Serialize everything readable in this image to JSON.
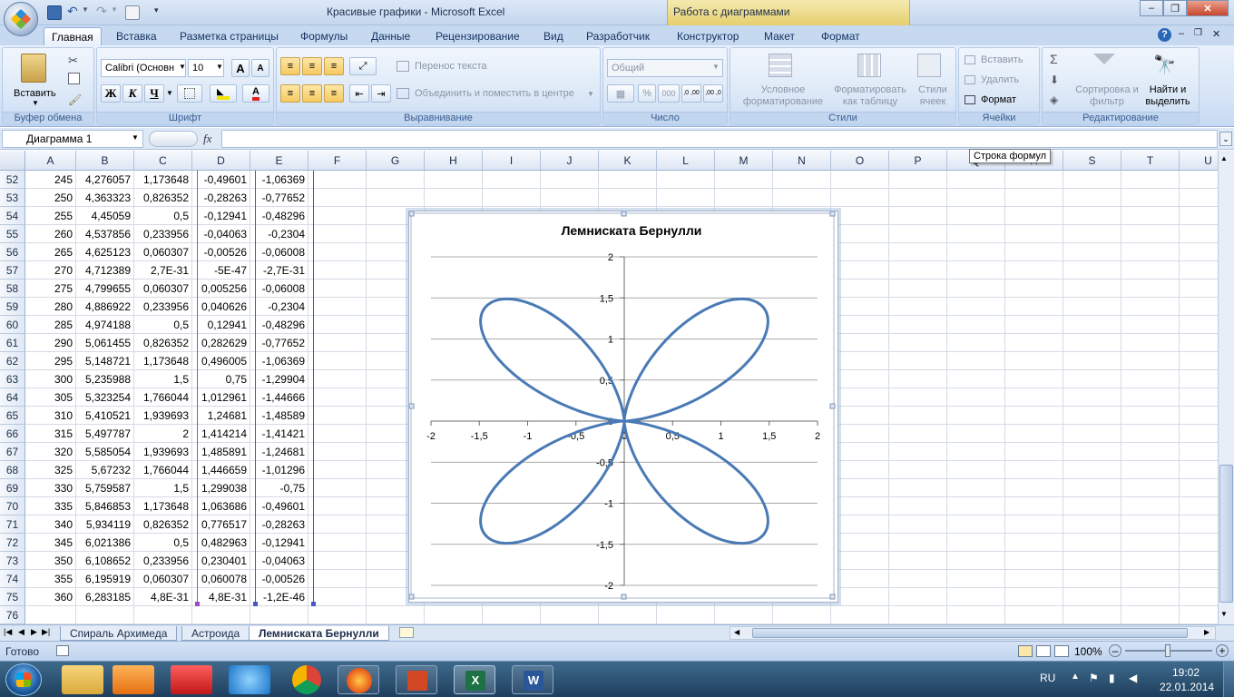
{
  "window": {
    "title": "Красивые графики - Microsoft Excel",
    "context_tab": "Работа с диаграммами"
  },
  "ribbon_tabs": [
    "Главная",
    "Вставка",
    "Разметка страницы",
    "Формулы",
    "Данные",
    "Рецензирование",
    "Вид",
    "Разработчик",
    "Конструктор",
    "Макет",
    "Формат"
  ],
  "ribbon": {
    "clipboard": {
      "paste": "Вставить",
      "label": "Буфер обмена"
    },
    "font": {
      "name": "Calibri (Основн",
      "size": "10",
      "label": "Шрифт",
      "bold": "Ж",
      "italic": "К",
      "underline": "Ч",
      "grow": "A",
      "shrink": "A",
      "color_a": "A"
    },
    "alignment": {
      "wrap": "Перенос текста",
      "merge": "Объединить и поместить в центре",
      "label": "Выравнивание"
    },
    "number": {
      "format": "Общий",
      "label": "Число",
      "percent": "%",
      "thousands": "000",
      "inc": ",0 ,00",
      "dec": ",00 ,0"
    },
    "styles": {
      "conditional": "Условное форматирование",
      "as_table": "Форматировать как таблицу",
      "cell_styles": "Стили ячеек",
      "label": "Стили"
    },
    "cells": {
      "insert": "Вставить",
      "delete": "Удалить",
      "format": "Формат",
      "label": "Ячейки"
    },
    "editing": {
      "sort": "Сортировка и фильтр",
      "find": "Найти и выделить",
      "label": "Редактирование",
      "sum": "Σ"
    }
  },
  "formula_bar": {
    "name_box": "Диаграмма 1",
    "fx": "fx",
    "formula": "",
    "tooltip": "Строка формул"
  },
  "columns": [
    "A",
    "B",
    "C",
    "D",
    "E",
    "F",
    "G",
    "H",
    "I",
    "J",
    "K",
    "L",
    "M",
    "N",
    "O",
    "P",
    "Q",
    "R",
    "S",
    "T",
    "U"
  ],
  "rows": [
    {
      "n": "52",
      "a": "245",
      "b": "4,276057",
      "c": "1,173648",
      "d": "-0,49601",
      "e": "-1,06369"
    },
    {
      "n": "53",
      "a": "250",
      "b": "4,363323",
      "c": "0,826352",
      "d": "-0,28263",
      "e": "-0,77652"
    },
    {
      "n": "54",
      "a": "255",
      "b": "4,45059",
      "c": "0,5",
      "d": "-0,12941",
      "e": "-0,48296"
    },
    {
      "n": "55",
      "a": "260",
      "b": "4,537856",
      "c": "0,233956",
      "d": "-0,04063",
      "e": "-0,2304"
    },
    {
      "n": "56",
      "a": "265",
      "b": "4,625123",
      "c": "0,060307",
      "d": "-0,00526",
      "e": "-0,06008"
    },
    {
      "n": "57",
      "a": "270",
      "b": "4,712389",
      "c": "2,7E-31",
      "d": "-5E-47",
      "e": "-2,7E-31"
    },
    {
      "n": "58",
      "a": "275",
      "b": "4,799655",
      "c": "0,060307",
      "d": "0,005256",
      "e": "-0,06008"
    },
    {
      "n": "59",
      "a": "280",
      "b": "4,886922",
      "c": "0,233956",
      "d": "0,040626",
      "e": "-0,2304"
    },
    {
      "n": "60",
      "a": "285",
      "b": "4,974188",
      "c": "0,5",
      "d": "0,12941",
      "e": "-0,48296"
    },
    {
      "n": "61",
      "a": "290",
      "b": "5,061455",
      "c": "0,826352",
      "d": "0,282629",
      "e": "-0,77652"
    },
    {
      "n": "62",
      "a": "295",
      "b": "5,148721",
      "c": "1,173648",
      "d": "0,496005",
      "e": "-1,06369"
    },
    {
      "n": "63",
      "a": "300",
      "b": "5,235988",
      "c": "1,5",
      "d": "0,75",
      "e": "-1,29904"
    },
    {
      "n": "64",
      "a": "305",
      "b": "5,323254",
      "c": "1,766044",
      "d": "1,012961",
      "e": "-1,44666"
    },
    {
      "n": "65",
      "a": "310",
      "b": "5,410521",
      "c": "1,939693",
      "d": "1,24681",
      "e": "-1,48589"
    },
    {
      "n": "66",
      "a": "315",
      "b": "5,497787",
      "c": "2",
      "d": "1,414214",
      "e": "-1,41421"
    },
    {
      "n": "67",
      "a": "320",
      "b": "5,585054",
      "c": "1,939693",
      "d": "1,485891",
      "e": "-1,24681"
    },
    {
      "n": "68",
      "a": "325",
      "b": "5,67232",
      "c": "1,766044",
      "d": "1,446659",
      "e": "-1,01296"
    },
    {
      "n": "69",
      "a": "330",
      "b": "5,759587",
      "c": "1,5",
      "d": "1,299038",
      "e": "-0,75"
    },
    {
      "n": "70",
      "a": "335",
      "b": "5,846853",
      "c": "1,173648",
      "d": "1,063686",
      "e": "-0,49601"
    },
    {
      "n": "71",
      "a": "340",
      "b": "5,934119",
      "c": "0,826352",
      "d": "0,776517",
      "e": "-0,28263"
    },
    {
      "n": "72",
      "a": "345",
      "b": "6,021386",
      "c": "0,5",
      "d": "0,482963",
      "e": "-0,12941"
    },
    {
      "n": "73",
      "a": "350",
      "b": "6,108652",
      "c": "0,233956",
      "d": "0,230401",
      "e": "-0,04063"
    },
    {
      "n": "74",
      "a": "355",
      "b": "6,195919",
      "c": "0,060307",
      "d": "0,060078",
      "e": "-0,00526"
    },
    {
      "n": "75",
      "a": "360",
      "b": "6,283185",
      "c": "4,8E-31",
      "d": "4,8E-31",
      "e": "-1,2E-46"
    },
    {
      "n": "76",
      "a": "",
      "b": "",
      "c": "",
      "d": "",
      "e": ""
    }
  ],
  "chart_data": {
    "type": "scatter",
    "title": "Лемниската Бернулли",
    "xlim": [
      -2,
      2
    ],
    "ylim": [
      -2,
      2
    ],
    "xticks": [
      "-2",
      "-1,5",
      "-1",
      "-0,5",
      "0",
      "0,5",
      "1",
      "1,5",
      "2"
    ],
    "yticks": [
      "2",
      "1,5",
      "1",
      "0,5",
      "0",
      "-0,5",
      "-1",
      "-1,5",
      "-2"
    ],
    "curve": "r = 2·|sin 2φ|, φ step 5°",
    "series": [
      {
        "color": "#4a7ab5",
        "line": "smooth",
        "x": [
          0,
          0.0603,
          0.2304,
          0.483,
          0.7765,
          1.0637,
          1.299,
          1.4467,
          1.4859,
          1.4142,
          1.2468,
          1.013,
          0.75,
          0.496,
          0.2826,
          0.1294,
          0.0406,
          0.0053,
          0,
          -0.0053,
          -0.0406,
          -0.1294,
          -0.2826,
          -0.496,
          -0.75,
          -1.013,
          -1.2468,
          -1.4142,
          -1.4859,
          -1.4467,
          -1.299,
          -1.0637,
          -0.7765,
          -0.483,
          -0.2304,
          -0.0603,
          0,
          -0.0603,
          -0.2304,
          -0.483,
          -0.7765,
          -1.0637,
          -1.299,
          -1.4467,
          -1.4859,
          -1.4142,
          -1.2468,
          -1.013,
          -0.75,
          -0.496,
          -0.2826,
          -0.1294,
          -0.0406,
          -0.0053,
          0,
          0.0053,
          0.0406,
          0.1294,
          0.2826,
          0.496,
          0.75,
          1.013,
          1.2468,
          1.4142,
          1.4859,
          1.4467,
          1.299,
          1.0637,
          0.7765,
          0.483,
          0.2304,
          0.0603,
          0
        ],
        "y": [
          0,
          0.0053,
          0.0406,
          0.1294,
          0.2826,
          0.496,
          0.75,
          1.013,
          1.2468,
          1.4142,
          1.4859,
          1.4467,
          1.299,
          1.0637,
          0.7765,
          0.483,
          0.2304,
          0.0603,
          0,
          0.0603,
          0.2304,
          0.483,
          0.7765,
          1.0637,
          1.299,
          1.4467,
          1.4859,
          1.4142,
          1.2468,
          1.013,
          0.75,
          0.496,
          0.2826,
          0.1294,
          0.0406,
          0.0053,
          0,
          -0.0053,
          -0.0406,
          -0.1294,
          -0.2826,
          -0.496,
          -0.75,
          -1.013,
          -1.2468,
          -1.4142,
          -1.4859,
          -1.4467,
          -1.299,
          -1.0637,
          -0.7765,
          -0.483,
          -0.2304,
          -0.0603,
          0,
          -0.0603,
          -0.2304,
          -0.483,
          -0.7765,
          -1.0637,
          -1.299,
          -1.4467,
          -1.4859,
          -1.4142,
          -1.2468,
          -1.013,
          -0.75,
          -0.496,
          -0.2826,
          -0.1294,
          -0.0406,
          -0.0053,
          0
        ]
      }
    ],
    "grid": "horizontal",
    "legend": "none"
  },
  "sheet_tabs": [
    "Спираль Архимеда",
    "Астроида",
    "Лемниската Бернулли"
  ],
  "active_sheet": 2,
  "status": {
    "mode": "Готово",
    "zoom": "100%"
  },
  "taskbar": {
    "lang": "RU",
    "time": "19:02",
    "date": "22.01.2014"
  }
}
